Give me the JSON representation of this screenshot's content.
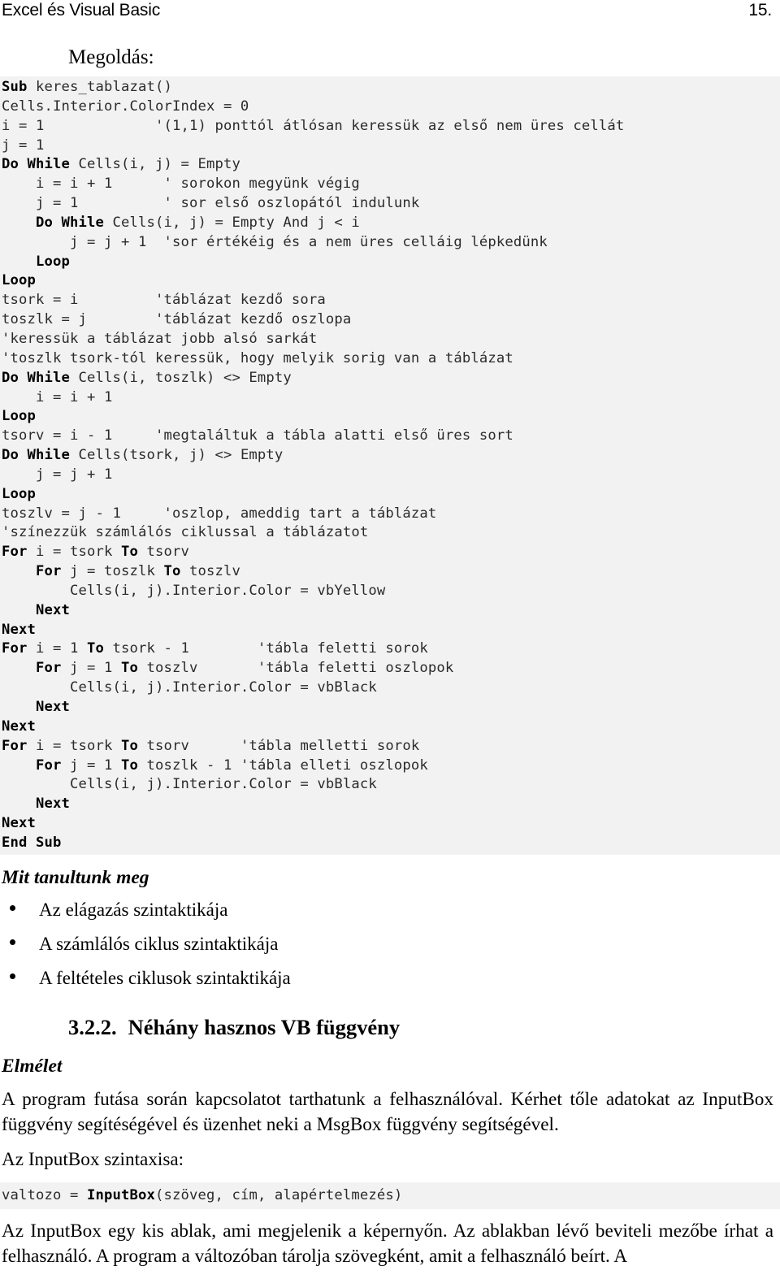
{
  "header": {
    "title": "Excel és Visual Basic",
    "page_number": "15."
  },
  "solution": {
    "label": "Megoldás:"
  },
  "code_main": [
    {
      "indent": 0,
      "kw": "Sub",
      "rest": " keres_tablazat()"
    },
    {
      "indent": 0,
      "kw": "",
      "rest": "Cells.Interior.ColorIndex = 0"
    },
    {
      "indent": 0,
      "kw": "",
      "rest": "i = 1             '(1,1) ponttól átlósan keressük az első nem üres cellát"
    },
    {
      "indent": 0,
      "kw": "",
      "rest": "j = 1"
    },
    {
      "indent": 0,
      "kw": "Do While",
      "rest": " Cells(i, j) = Empty"
    },
    {
      "indent": 0,
      "kw": "",
      "rest": "    i = i + 1      ' sorokon megyünk végig"
    },
    {
      "indent": 0,
      "kw": "",
      "rest": "    j = 1          ' sor első oszlopától indulunk"
    },
    {
      "indent": 4,
      "kw": "Do While",
      "rest": " Cells(i, j) = Empty And j < i"
    },
    {
      "indent": 0,
      "kw": "",
      "rest": "        j = j + 1  'sor értékéig és a nem üres celláig lépkedünk"
    },
    {
      "indent": 4,
      "kw": "Loop",
      "rest": ""
    },
    {
      "indent": 0,
      "kw": "Loop",
      "rest": ""
    },
    {
      "indent": 0,
      "kw": "",
      "rest": "tsork = i         'táblázat kezdő sora"
    },
    {
      "indent": 0,
      "kw": "",
      "rest": "toszlk = j        'táblázat kezdő oszlopa"
    },
    {
      "indent": 0,
      "kw": "",
      "rest": "'keressük a táblázat jobb alsó sarkát"
    },
    {
      "indent": 0,
      "kw": "",
      "rest": "'toszlk tsork-tól keressük, hogy melyik sorig van a táblázat"
    },
    {
      "indent": 0,
      "kw": "Do While",
      "rest": " Cells(i, toszlk) <> Empty"
    },
    {
      "indent": 0,
      "kw": "",
      "rest": "    i = i + 1"
    },
    {
      "indent": 0,
      "kw": "Loop",
      "rest": ""
    },
    {
      "indent": 0,
      "kw": "",
      "rest": "tsorv = i - 1     'megtaláltuk a tábla alatti első üres sort"
    },
    {
      "indent": 0,
      "kw": "Do While",
      "rest": " Cells(tsork, j) <> Empty"
    },
    {
      "indent": 0,
      "kw": "",
      "rest": "    j = j + 1"
    },
    {
      "indent": 0,
      "kw": "Loop",
      "rest": ""
    },
    {
      "indent": 0,
      "kw": "",
      "rest": "toszlv = j - 1     'oszlop, ameddig tart a táblázat"
    },
    {
      "indent": 0,
      "kw": "",
      "rest": "'színezzük számlálós ciklussal a táblázatot"
    },
    {
      "indent": 0,
      "kw": "For",
      "rest": " i = tsork To tsorv",
      "kw2": "To",
      "pattern": "for-a"
    },
    {
      "indent": 4,
      "kw": "For",
      "rest": " j = toszlk To toszlv",
      "pattern": "for-a"
    },
    {
      "indent": 0,
      "kw": "",
      "rest": "        Cells(i, j).Interior.Color = vbYellow"
    },
    {
      "indent": 4,
      "kw": "Next",
      "rest": ""
    },
    {
      "indent": 0,
      "kw": "Next",
      "rest": ""
    },
    {
      "indent": 0,
      "kw": "For",
      "rest": " i = 1 To tsork - 1        'tábla feletti sorok",
      "pattern": "for-a"
    },
    {
      "indent": 4,
      "kw": "For",
      "rest": " j = 1 To toszlv       'tábla feletti oszlopok",
      "pattern": "for-a"
    },
    {
      "indent": 0,
      "kw": "",
      "rest": "        Cells(i, j).Interior.Color = vbBlack"
    },
    {
      "indent": 4,
      "kw": "Next",
      "rest": ""
    },
    {
      "indent": 0,
      "kw": "Next",
      "rest": ""
    },
    {
      "indent": 0,
      "kw": "For",
      "rest": " i = tsork To tsorv      'tábla melletti sorok",
      "pattern": "for-a"
    },
    {
      "indent": 4,
      "kw": "For",
      "rest": " j = 1 To toszlk - 1 'tábla elleti oszlopok",
      "pattern": "for-a"
    },
    {
      "indent": 0,
      "kw": "",
      "rest": "        Cells(i, j).Interior.Color = vbBlack"
    },
    {
      "indent": 4,
      "kw": "Next",
      "rest": ""
    },
    {
      "indent": 0,
      "kw": "Next",
      "rest": ""
    },
    {
      "indent": 0,
      "kw": "End Sub",
      "rest": ""
    }
  ],
  "learned": {
    "heading": "Mit tanultunk meg",
    "items": [
      "Az elágazás szintaktikája",
      "A számlálós ciklus szintaktikája",
      "A feltételes ciklusok szintaktikája"
    ]
  },
  "section": {
    "number": "3.2.2.",
    "title": "Néhány hasznos VB függvény"
  },
  "theory": {
    "heading": "Elmélet",
    "paragraph1": "A program futása során kapcsolatot tarthatunk a felhasználóval. Kérhet tőle adatokat az InputBox függvény segítéségével és üzenhet neki a MsgBox függvény segítségével.",
    "paragraph2": "Az InputBox szintaxisa:",
    "paragraph3": "Az InputBox egy kis ablak, ami megjelenik a képernyőn. Az ablakban lévő beviteli mezőbe írhat a felhasználó. A program a változóban tárolja szövegként, amit a felhasználó beírt. A"
  },
  "code_syntax": {
    "prefix": "valtozo = ",
    "keyword": "InputBox",
    "suffix": "(szöveg, cím, alapértelmezés)"
  },
  "colors": {
    "code_background": "#f2f2f2",
    "text": "#000000",
    "code_text": "#2b2b2b"
  }
}
